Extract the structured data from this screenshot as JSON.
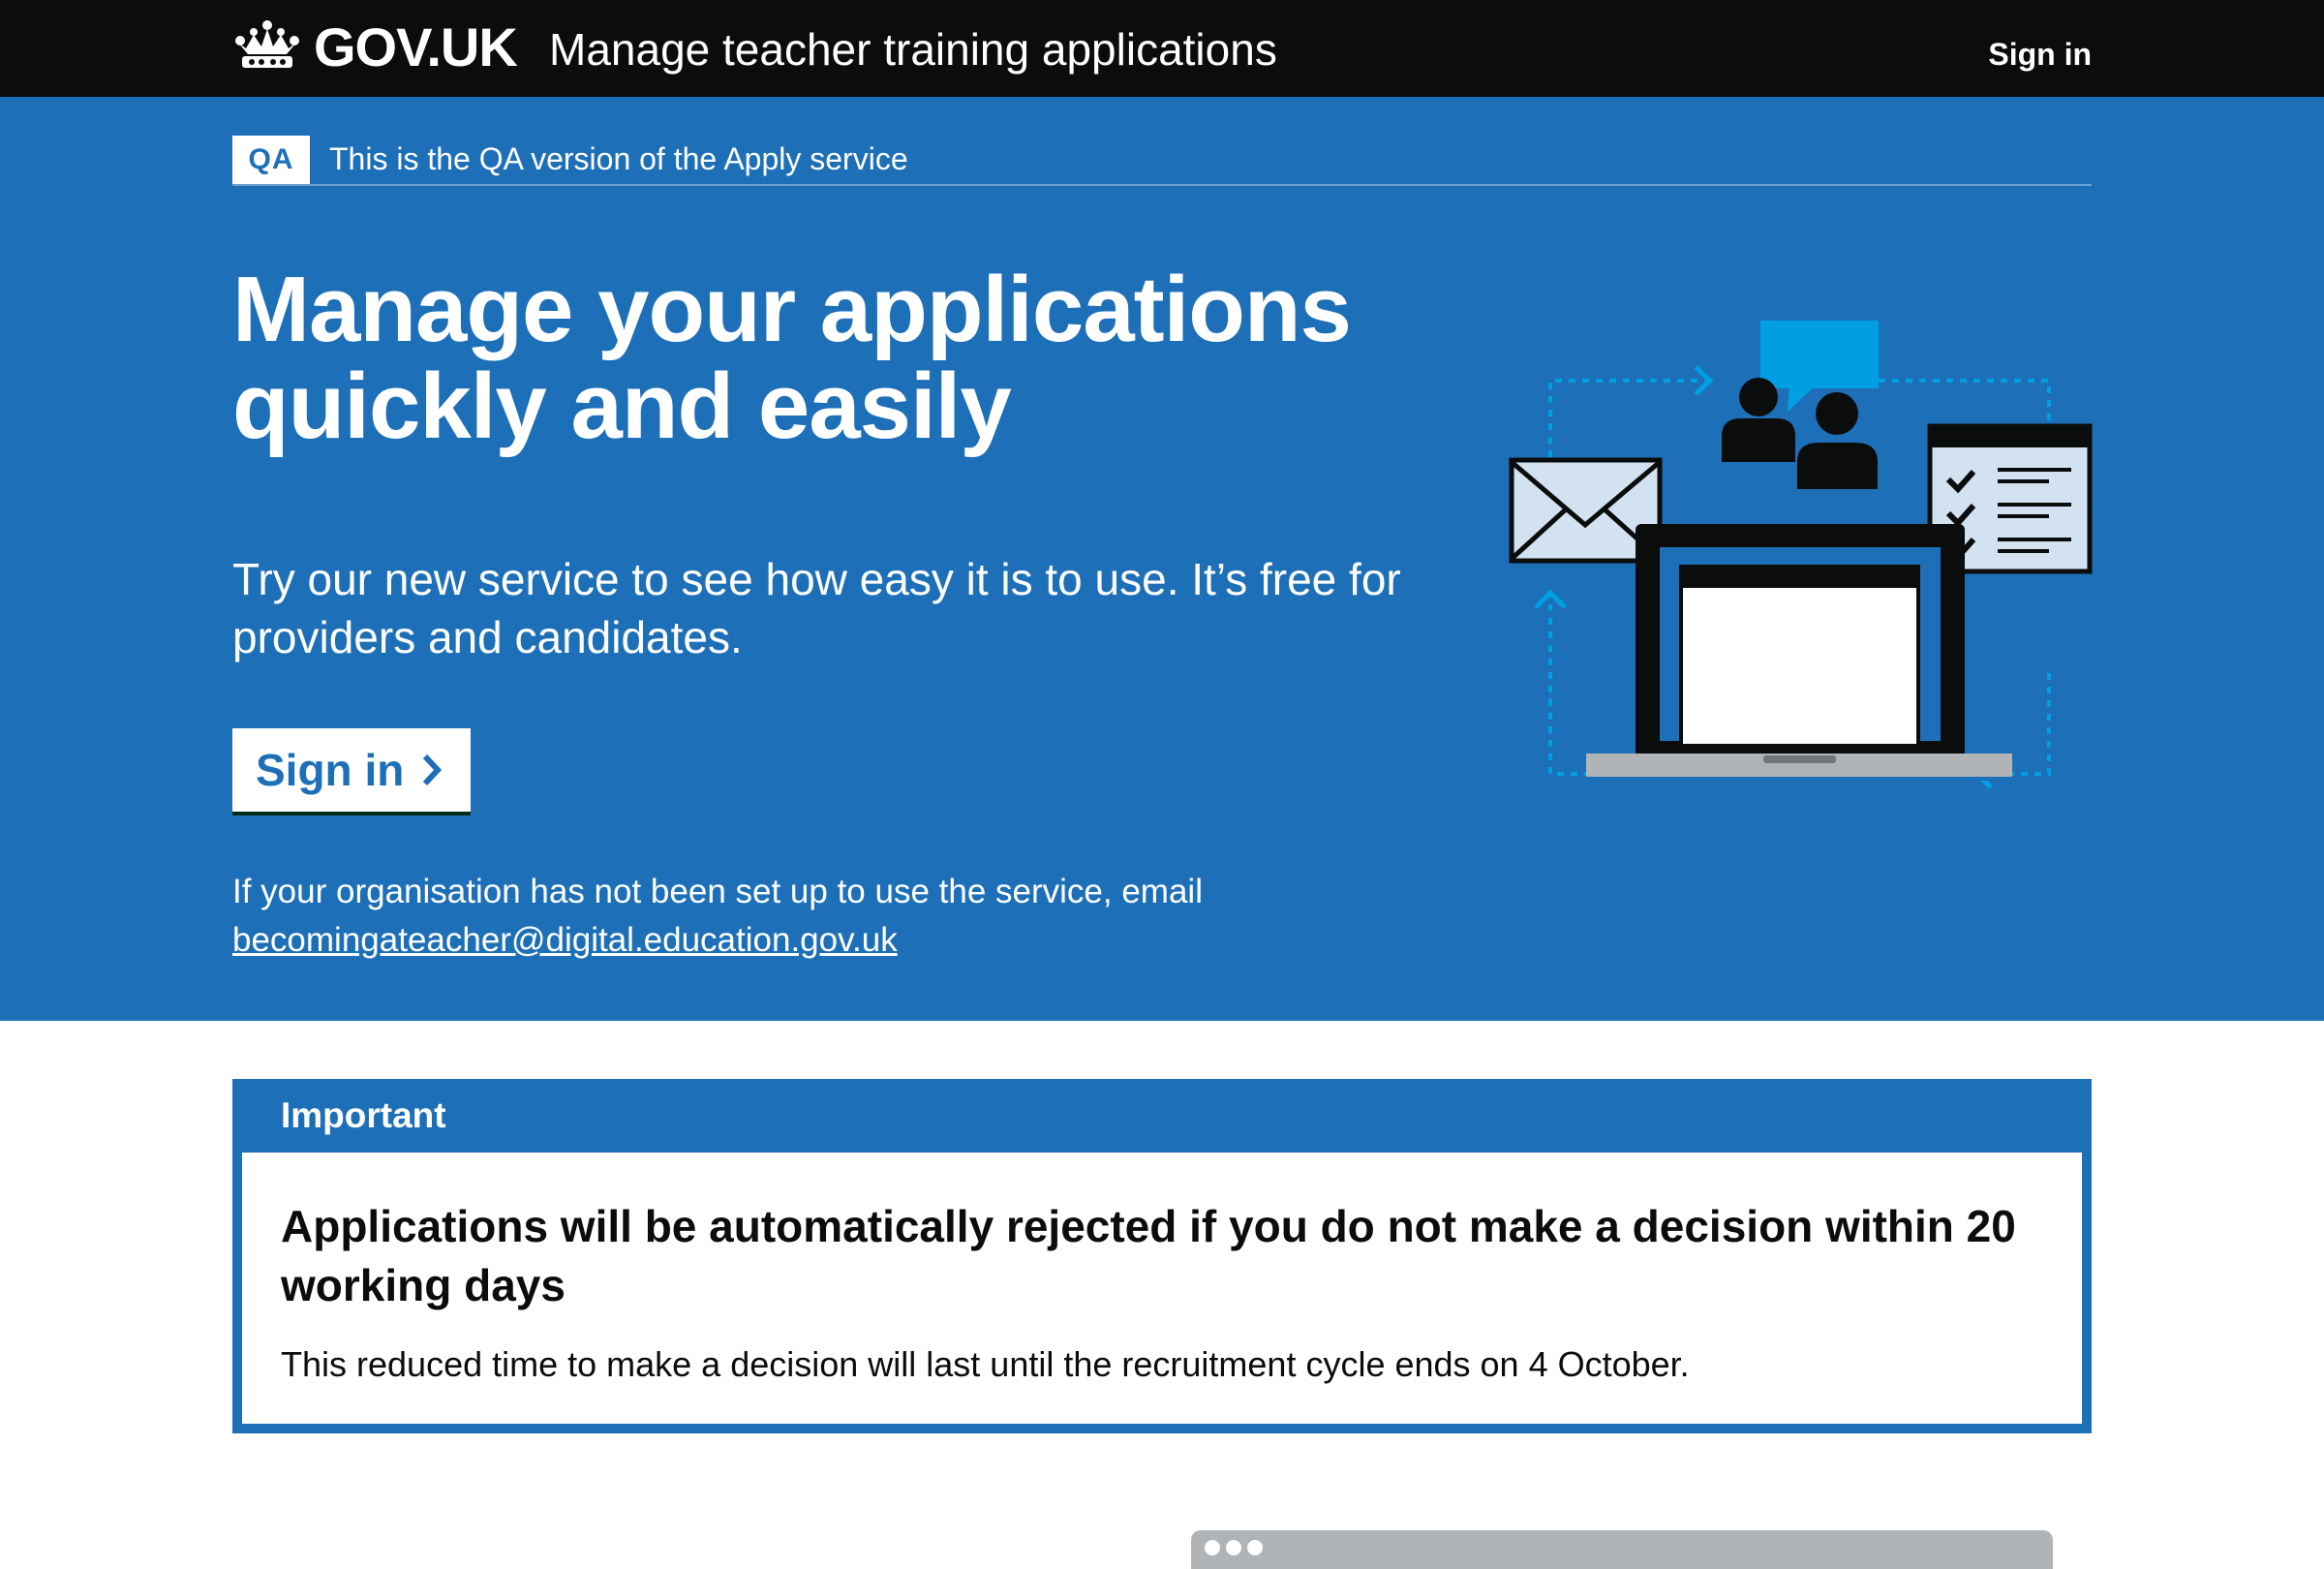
{
  "header": {
    "logo_text": "GOV.UK",
    "service_name": "Manage teacher training applications",
    "sign_in_label": "Sign in"
  },
  "phase_banner": {
    "tag": "QA",
    "text": "This is the QA version of the Apply service"
  },
  "hero": {
    "title_line1": "Manage your applications",
    "title_line2": "quickly and easily",
    "lede": "Try our new service to see how easy it is to use. It’s free for providers and candidates.",
    "button_label": "Sign in",
    "note": "If your organisation has not been set up to use the service, email",
    "email": "becomingateacher@digital.education.gov.uk"
  },
  "notice": {
    "title": "Important",
    "heading": "Applications will be automatically rejected if you do not make a decision within 20 working days",
    "body": "This reduced time to make a decision will last until the recruitment cycle ends on 4 October."
  },
  "icons": {
    "crown": "crown-icon",
    "chevron": "chevron-right-icon",
    "envelope": "envelope-icon",
    "people": "people-icon",
    "chat": "chat-bubble-icon",
    "checklist": "checklist-icon",
    "laptop": "laptop-icon"
  },
  "colors": {
    "header_bg": "#0b0c0c",
    "brand_blue": "#1d70b8",
    "white": "#ffffff",
    "text": "#0b0c0c",
    "illustration_light_blue": "#009fe3"
  }
}
